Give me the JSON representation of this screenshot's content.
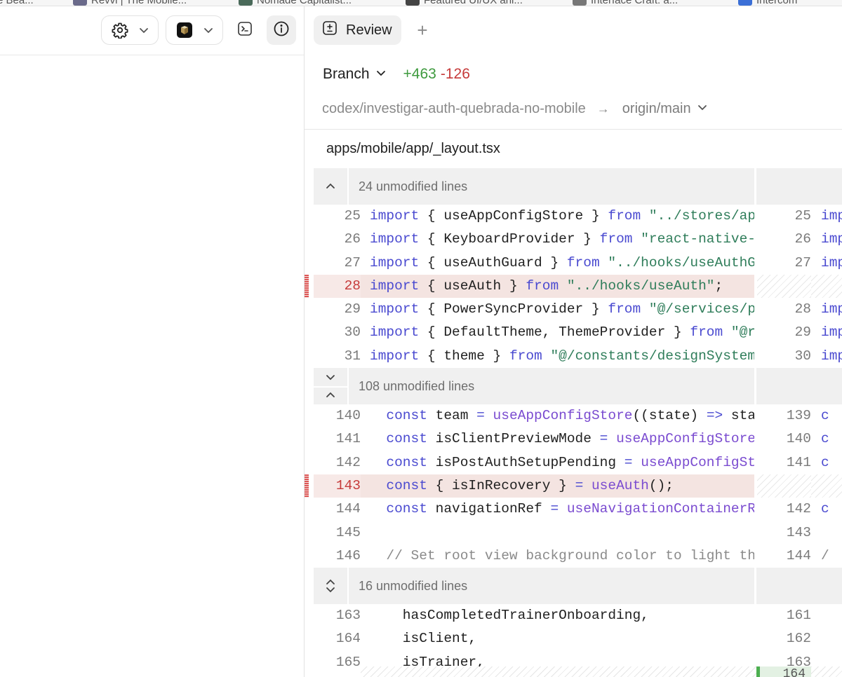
{
  "bookmarks": [
    {
      "label": "e Bea..."
    },
    {
      "label": "Revvi | The Mobile..."
    },
    {
      "label": "Nomade Capitalist..."
    },
    {
      "label": "Featured UI/UX ani..."
    },
    {
      "label": "Interface Craft: a..."
    },
    {
      "label": "Intercom"
    }
  ],
  "left_toolbar": {
    "settings_icon": "gear-icon",
    "app_icon": "cube-app-icon",
    "terminal_icon": "terminal-icon",
    "info_icon": "info-icon"
  },
  "tabs": {
    "review_label": "Review",
    "add_label": "+"
  },
  "diff_header": {
    "branch_label": "Branch",
    "added": "+463",
    "removed": "-126",
    "source_branch": "codex/investigar-auth-quebrada-no-mobile",
    "arrow": "→",
    "target_branch": "origin/main"
  },
  "file": {
    "path": "apps/mobile/app/_layout.tsx"
  },
  "hunks": [
    {
      "label": "24 unmodified lines"
    },
    {
      "label": "108 unmodified lines"
    },
    {
      "label": "16 unmodified lines"
    }
  ],
  "lines": {
    "l25": {
      "old": "25",
      "new": "25",
      "right": "imp"
    },
    "l26": {
      "old": "26",
      "new": "26",
      "right": "imp"
    },
    "l27": {
      "old": "27",
      "new": "27",
      "right": "imp"
    },
    "l28": {
      "old": "28",
      "new": "",
      "right": ""
    },
    "l29": {
      "old": "29",
      "new": "28",
      "right": "imp"
    },
    "l30": {
      "old": "30",
      "new": "29",
      "right": "imp"
    },
    "l31": {
      "old": "31",
      "new": "30",
      "right": "imp"
    },
    "l140": {
      "old": "140",
      "new": "139",
      "right": "c"
    },
    "l141": {
      "old": "141",
      "new": "140",
      "right": "c"
    },
    "l142": {
      "old": "142",
      "new": "141",
      "right": "c"
    },
    "l143": {
      "old": "143",
      "new": "",
      "right": ""
    },
    "l144": {
      "old": "144",
      "new": "142",
      "right": "c"
    },
    "l145": {
      "old": "145",
      "new": "143",
      "right": ""
    },
    "l146": {
      "old": "146",
      "new": "144",
      "right": "/"
    },
    "l163": {
      "old": "163",
      "new": "161",
      "right": ""
    },
    "l164": {
      "old": "164",
      "new": "162",
      "right": ""
    },
    "l165": {
      "old": "165",
      "new": "163",
      "right": ""
    }
  },
  "bottom_partial_line": "164",
  "colors": {
    "added": "#3e9a3e",
    "removed": "#c63a3a",
    "deleted_row_bg": "#f4e4e1",
    "keyword": "#4a4ad0",
    "string": "#2f7d5a",
    "function": "#7a4bd0"
  }
}
